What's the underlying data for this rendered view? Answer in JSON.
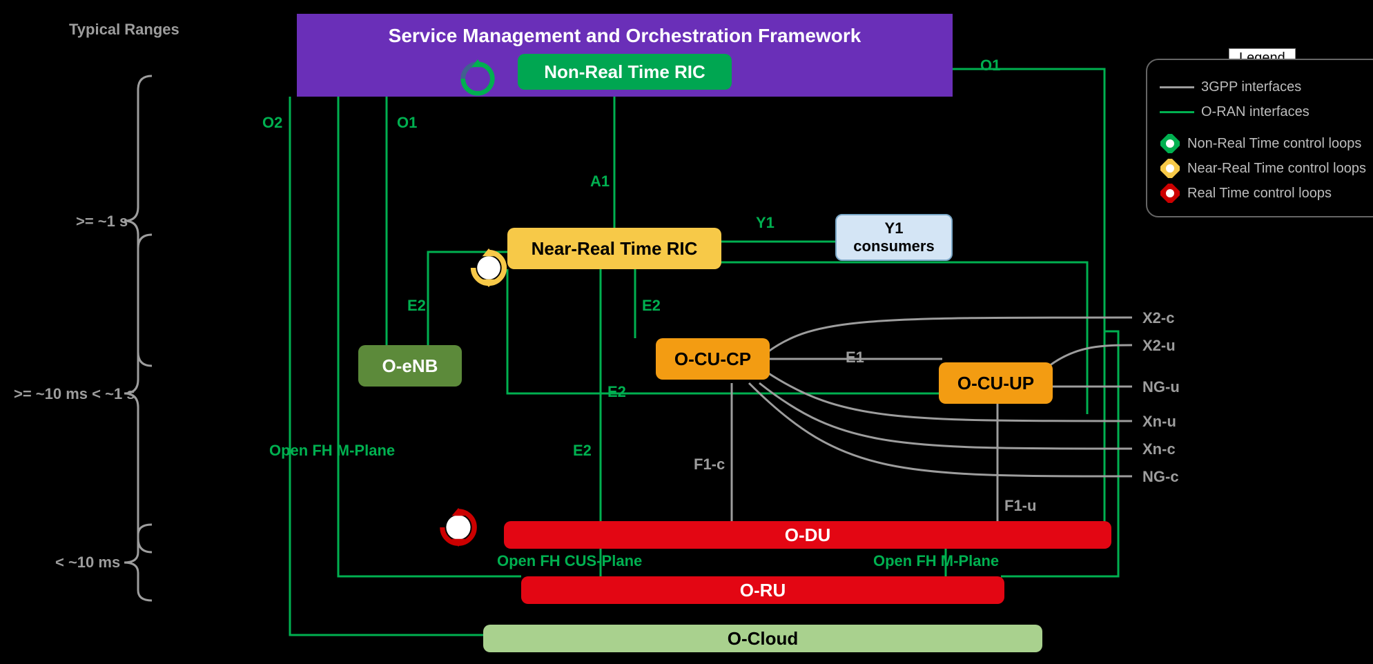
{
  "typical_ranges_header": "Typical Ranges",
  "ranges": {
    "r1": ">= ~1 s",
    "r2": ">= ~10 ms < ~1 s",
    "r3": "< ~10 ms"
  },
  "smo_title": "Service Management and Orchestration Framework",
  "blocks": {
    "non_rt_ric": "Non-Real Time RIC",
    "near_rt_ric": "Near-Real Time RIC",
    "o_enb": "O-eNB",
    "o_cu_cp": "O-CU-CP",
    "o_cu_up": "O-CU-UP",
    "y1_consumers": "Y1\nconsumers",
    "o_du": "O-DU",
    "o_ru": "O-RU",
    "o_cloud": "O-Cloud"
  },
  "edges": {
    "O2": "O2",
    "O1_left": "O1",
    "O1_right": "O1",
    "A1": "A1",
    "Y1": "Y1",
    "E2a": "E2",
    "E2b": "E2",
    "E2c": "E2",
    "E2d": "E2",
    "E1": "E1",
    "F1c": "F1-c",
    "F1u": "F1-u",
    "open_fh_m_plane_left": "Open FH M-Plane",
    "open_fh_cus_plane": "Open FH CUS-Plane",
    "open_fh_m_plane_right": "Open FH M-Plane",
    "X2c": "X2-c",
    "X2u": "X2-u",
    "NGu": "NG-u",
    "Xnu": "Xn-u",
    "Xnc": "Xn-c",
    "NGc": "NG-c"
  },
  "legend": {
    "title": "Legend",
    "items": {
      "g3pp": "3GPP interfaces",
      "oran": "O-RAN interfaces",
      "non_rt": "Non-Real Time control loops",
      "near_rt": "Near-Real Time control loops",
      "rt": "Real Time control loops"
    }
  }
}
